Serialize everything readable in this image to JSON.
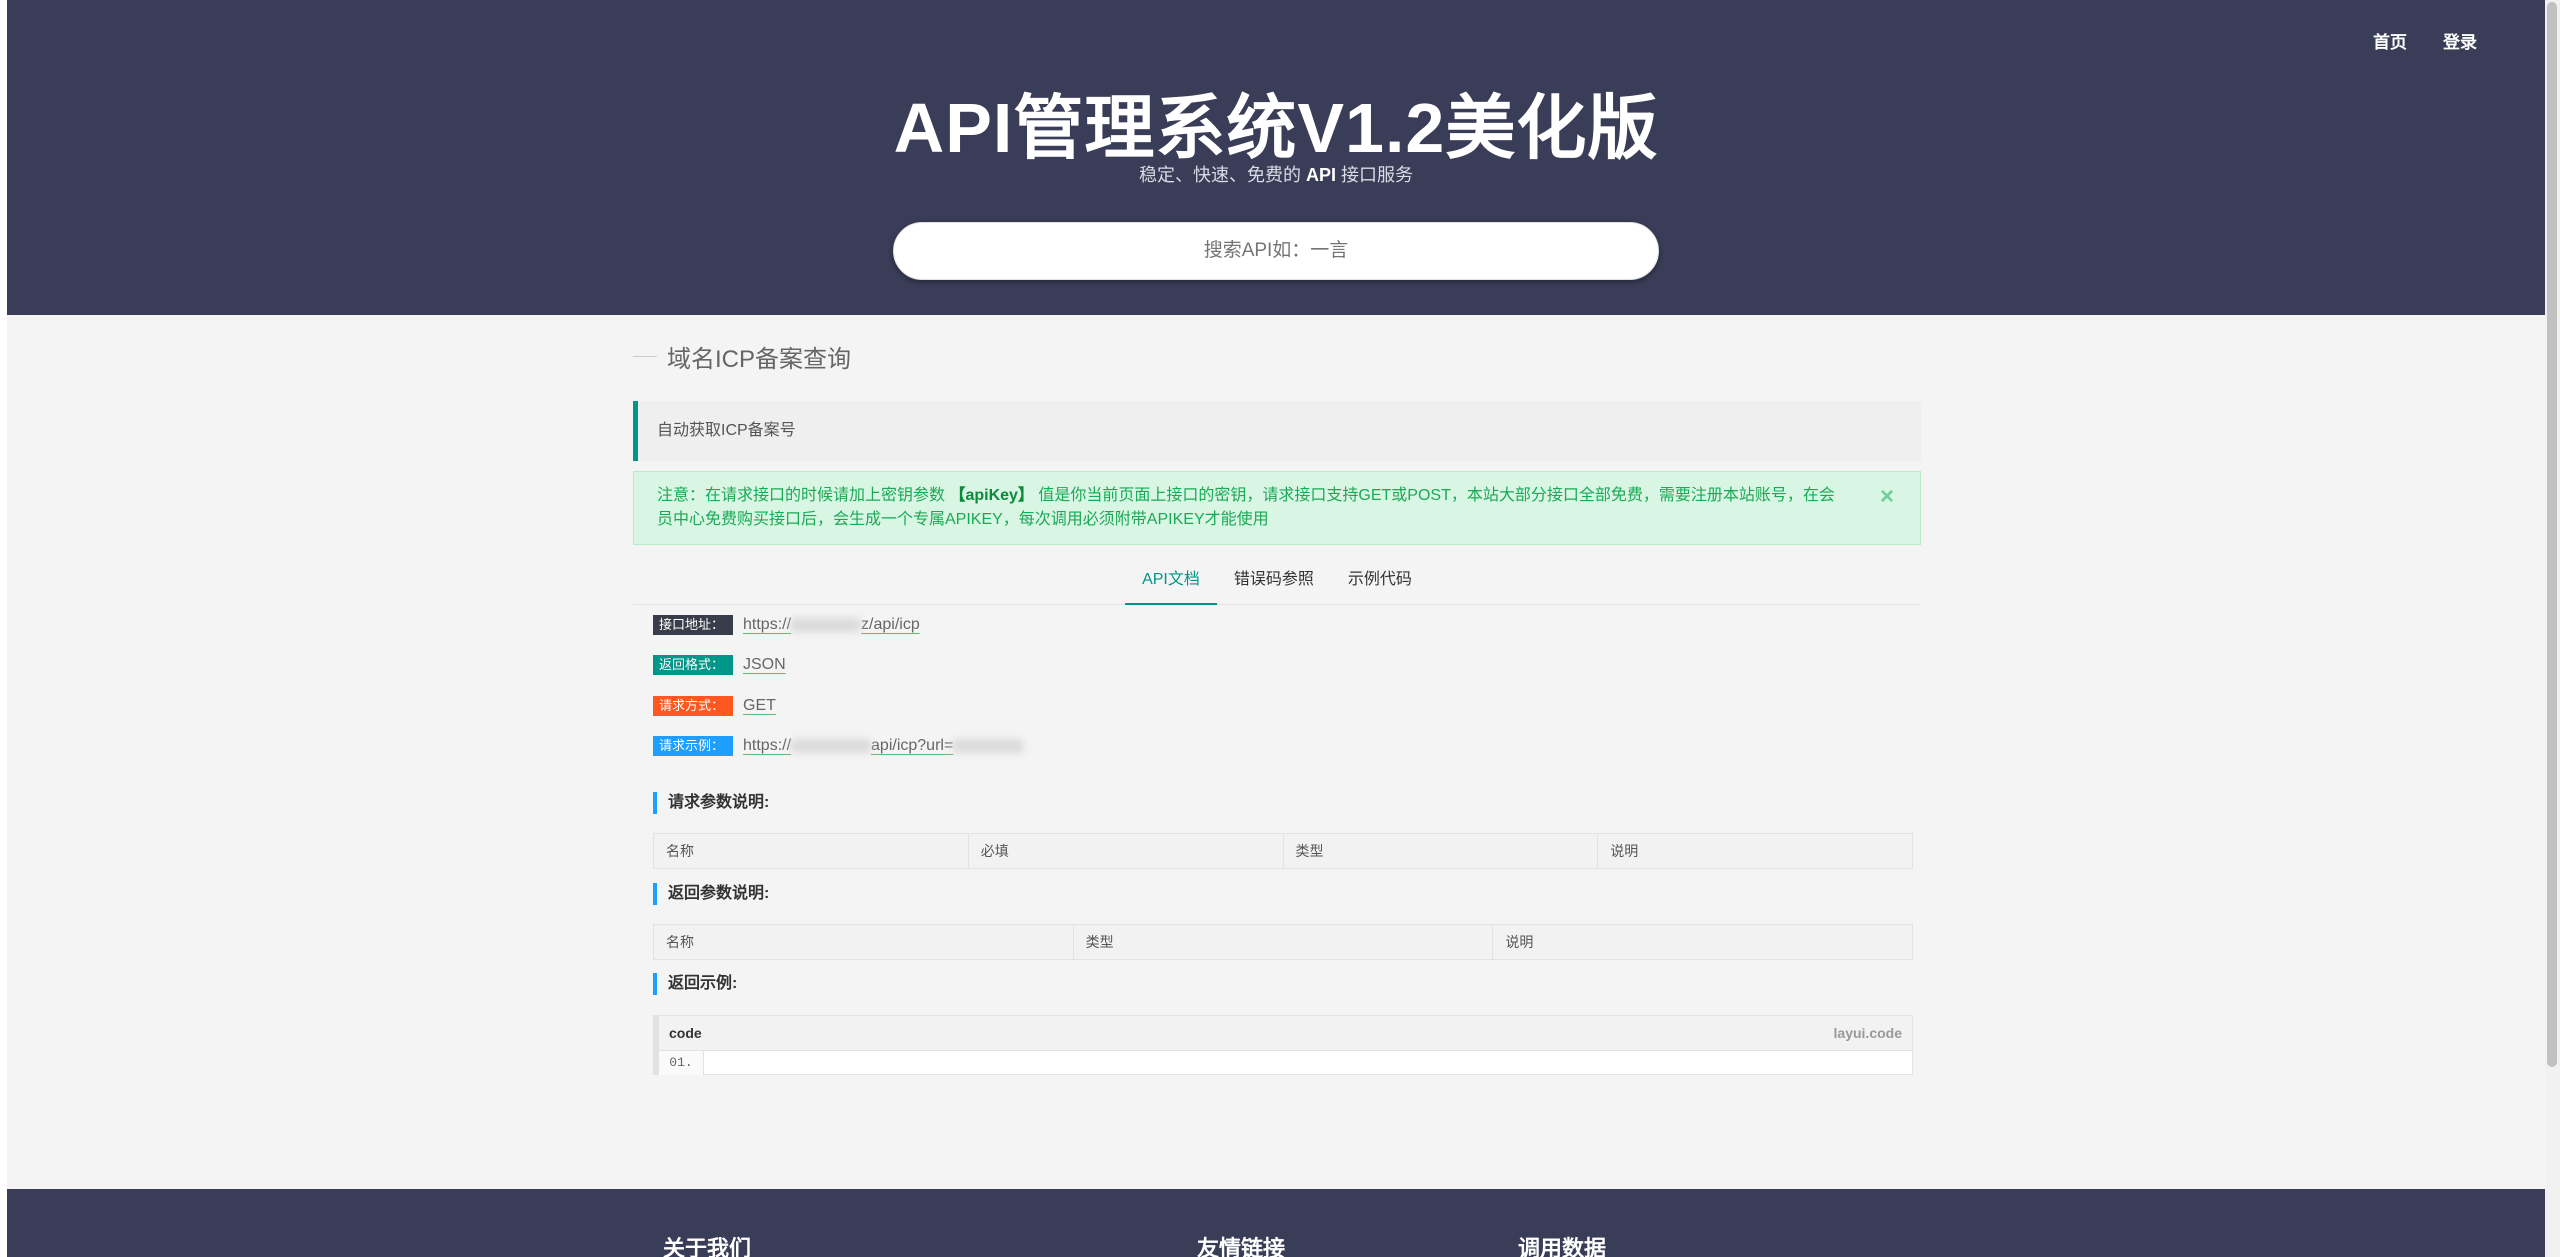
{
  "nav": {
    "home": "首页",
    "login": "登录"
  },
  "header": {
    "title": "API管理系统V1.2美化版",
    "subtitle_before": "稳定、快速、免费的 ",
    "subtitle_api": "API",
    "subtitle_after": " 接口服务",
    "search_placeholder": "搜索API如：一言"
  },
  "page": {
    "title": "域名ICP备案查询",
    "description": "自动获取ICP备案号",
    "notice_prefix": "注意：在请求接口的时候请加上密钥参数 ",
    "notice_key": "【apiKey】",
    "notice_suffix": " 值是你当前页面上接口的密钥，请求接口支持GET或POST，本站大部分接口全部免费，需要注册本站账号，在会员中心免费购买接口后，会生成一个专属APIKEY，每次调用必须附带APIKEY才能使用",
    "notice_close": "×"
  },
  "tabs": [
    "API文档",
    "错误码参照",
    "示例代码"
  ],
  "info": {
    "url_label": "接口地址：",
    "url_prefix": "https://",
    "url_suffix": "z/api/icp",
    "format_label": "返回格式：",
    "format_value": "JSON",
    "method_label": "请求方式：",
    "method_value": "GET",
    "example_label": "请求示例：",
    "example_prefix": "https://",
    "example_suffix": "api/icp?url=",
    "badge_colors": {
      "url": "#393d49",
      "format": "#009688",
      "method": "#ff5722",
      "example": "#1e9fff"
    }
  },
  "request_params": {
    "title": "请求参数说明:",
    "headers": [
      "名称",
      "必填",
      "类型",
      "说明"
    ]
  },
  "response_params": {
    "title": "返回参数说明:",
    "headers": [
      "名称",
      "类型",
      "说明"
    ]
  },
  "return_example": {
    "title": "返回示例:",
    "code_label": "code",
    "code_brand": "layui.code",
    "line_number": "01."
  },
  "footer": {
    "about": "关于我们",
    "links": "友情链接",
    "stats": "调用数据"
  }
}
